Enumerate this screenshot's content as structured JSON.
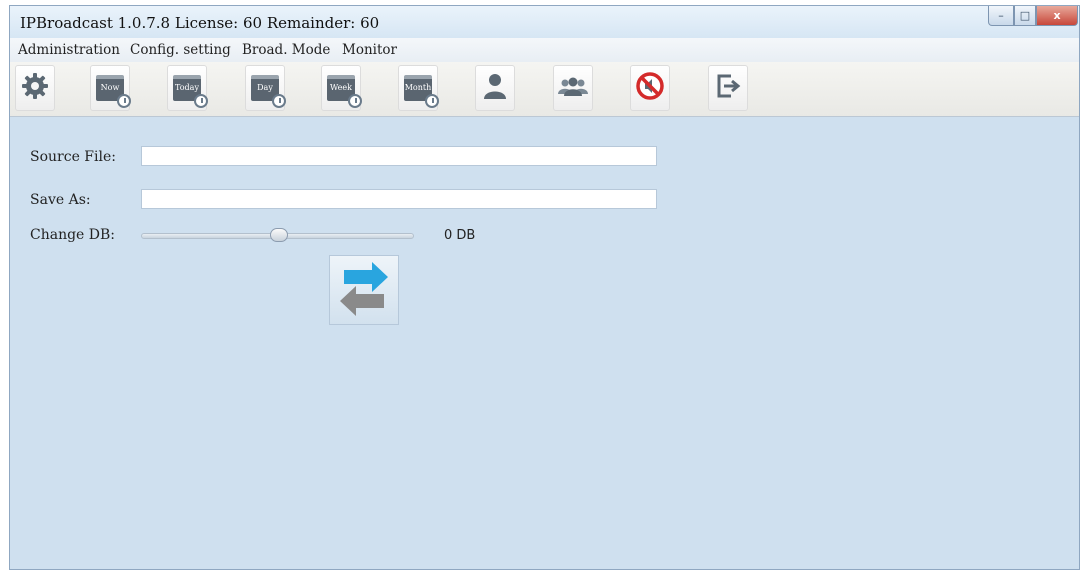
{
  "window": {
    "title": "IPBroadcast 1.0.7.8 License: 60 Remainder: 60",
    "controls": {
      "minimize": "–",
      "maximize": "□",
      "close": "x"
    }
  },
  "menu": [
    {
      "label": "Administration"
    },
    {
      "label": "Config. setting"
    },
    {
      "label": "Broad. Mode"
    },
    {
      "label": "Monitor"
    }
  ],
  "toolbar": {
    "buttons": [
      {
        "icon": "gear-icon"
      },
      {
        "icon": "calendar-now-icon",
        "label": "Now"
      },
      {
        "icon": "calendar-today-icon",
        "label": "Today"
      },
      {
        "icon": "calendar-day-icon",
        "label": "Day"
      },
      {
        "icon": "calendar-week-icon",
        "label": "Week"
      },
      {
        "icon": "calendar-month-icon",
        "label": "Month"
      },
      {
        "icon": "user-icon"
      },
      {
        "icon": "group-icon"
      },
      {
        "icon": "mute-icon"
      },
      {
        "icon": "logout-icon"
      }
    ]
  },
  "form": {
    "source_file": {
      "label": "Source File:",
      "value": ""
    },
    "save_as": {
      "label": "Save As:",
      "value": ""
    },
    "change_db": {
      "label": "Change DB:",
      "value": 0,
      "value_label": "0 DB"
    }
  },
  "colors": {
    "client_bg": "#cfe0ef",
    "arrow_blue": "#29a5df",
    "arrow_gray": "#8a8a8a",
    "mute_red": "#d42a2a"
  }
}
